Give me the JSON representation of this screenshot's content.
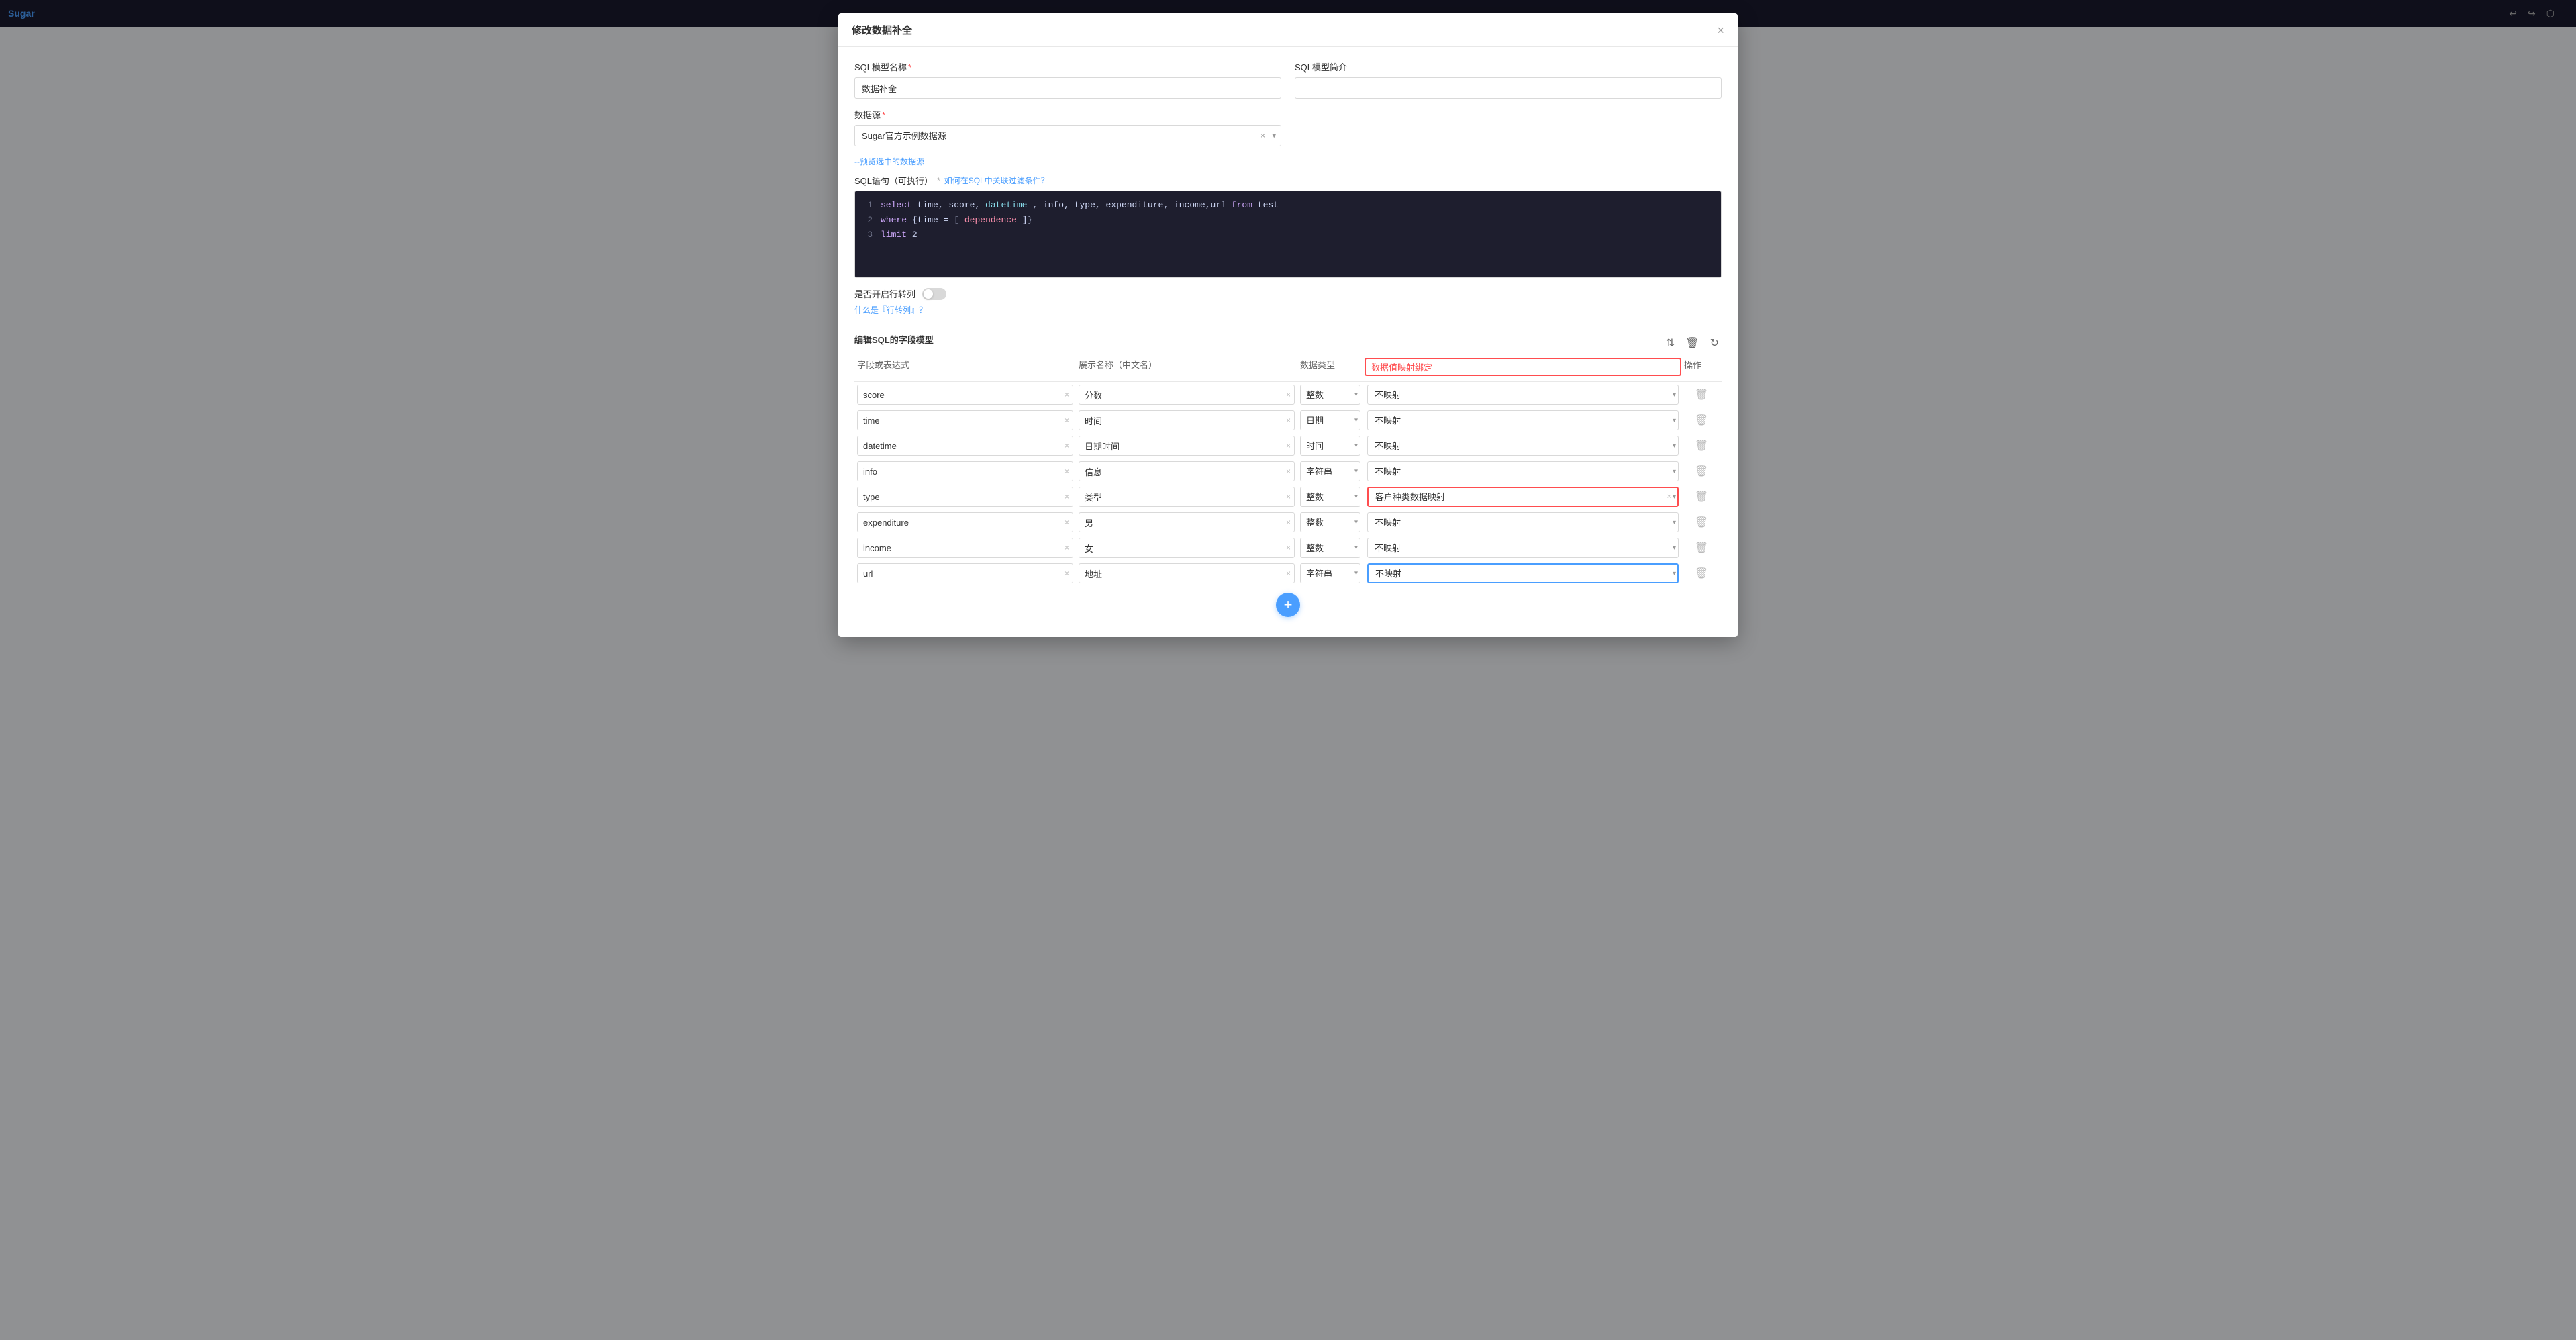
{
  "modal": {
    "title": "修改数据补全",
    "close_label": "×"
  },
  "form": {
    "model_name_label": "SQL模型名称",
    "model_name_required": "*",
    "model_name_value": "数据补全",
    "model_desc_label": "SQL模型简介",
    "model_desc_value": "",
    "datasource_label": "数据源",
    "datasource_required": "*",
    "datasource_value": "Sugar官方示例数据源",
    "preview_link": "--预览选中的数据源",
    "sql_label": "SQL语句（可执行）",
    "sql_optional": "*",
    "sql_help_link": "如何在SQL中关联过滤条件？",
    "sql_lines": [
      {
        "num": "1",
        "code": "select time, score, datetime, info, type, expenditure, income,url from test"
      },
      {
        "num": "2",
        "code": "where {time = [dependence]}"
      },
      {
        "num": "3",
        "code": "limit 2"
      }
    ],
    "row_transform_label": "是否开启行转列",
    "row_transform_link": "什么是『行转列』？",
    "field_model_label": "编辑SQL的字段模型"
  },
  "table": {
    "col_field": "字段或表达式",
    "col_display": "展示名称（中文名）",
    "col_type": "数据类型",
    "col_mapping": "数据值映射绑定",
    "col_action": "操作",
    "rows": [
      {
        "field": "score",
        "display": "分数",
        "type": "整数",
        "mapping": "不映射",
        "url_highlighted": false,
        "mapping_highlighted": false,
        "customer_mapping": false
      },
      {
        "field": "time",
        "display": "时间",
        "type": "日期",
        "mapping": "不映射",
        "url_highlighted": false,
        "mapping_highlighted": false,
        "customer_mapping": false
      },
      {
        "field": "datetime",
        "display": "日期时间",
        "type": "时间",
        "mapping": "不映射",
        "url_highlighted": false,
        "mapping_highlighted": false,
        "customer_mapping": false
      },
      {
        "field": "info",
        "display": "信息",
        "type": "字符串",
        "mapping": "不映射",
        "url_highlighted": false,
        "mapping_highlighted": false,
        "customer_mapping": false
      },
      {
        "field": "type",
        "display": "类型",
        "type": "整数",
        "mapping": "客户种类数据映射",
        "url_highlighted": false,
        "mapping_highlighted": true,
        "customer_mapping": true
      },
      {
        "field": "expenditure",
        "display": "男",
        "type": "整数",
        "mapping": "不映射",
        "url_highlighted": false,
        "mapping_highlighted": false,
        "customer_mapping": false
      },
      {
        "field": "income",
        "display": "女",
        "type": "整数",
        "mapping": "不映射",
        "url_highlighted": false,
        "mapping_highlighted": false,
        "customer_mapping": false
      },
      {
        "field": "url",
        "display": "地址",
        "type": "字符串",
        "mapping": "不映射",
        "url_highlighted": true,
        "mapping_highlighted": false,
        "customer_mapping": false
      }
    ]
  },
  "buttons": {
    "add_icon": "+",
    "delete_icon": "🗑",
    "sort_up_icon": "↑",
    "sort_down_icon": "↓",
    "refresh_icon": "↻"
  }
}
